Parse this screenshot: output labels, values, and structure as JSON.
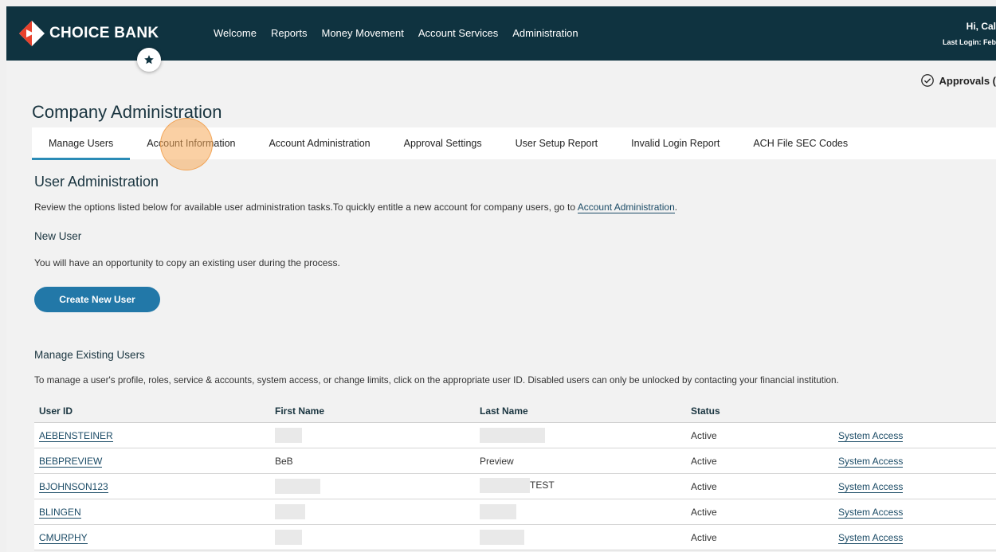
{
  "brand": {
    "name": "CHOICE BANK"
  },
  "nav": [
    "Welcome",
    "Reports",
    "Money Movement",
    "Account Services",
    "Administration"
  ],
  "user": {
    "greeting": "Hi, Cal",
    "last_login": "Last Login: Feb"
  },
  "approvals": {
    "label": "Approvals ("
  },
  "page": {
    "title": "Company Administration"
  },
  "tabs": [
    {
      "label": "Manage Users",
      "active": true
    },
    {
      "label": "Account Information"
    },
    {
      "label": "Account Administration"
    },
    {
      "label": "Approval Settings"
    },
    {
      "label": "User Setup Report"
    },
    {
      "label": "Invalid Login Report"
    },
    {
      "label": "ACH File SEC Codes"
    }
  ],
  "user_admin": {
    "title": "User Administration",
    "desc_text": "Review the options listed below for available user administration tasks.To quickly entitle a new account for company users, go to ",
    "desc_link": "Account Administration",
    "desc_tail": ".",
    "new_user_title": "New User",
    "new_user_desc": "You will have an opportunity to copy an existing user during the process.",
    "create_button": "Create New User",
    "manage_title": "Manage Existing Users",
    "manage_desc": "To manage a user's profile, roles, service & accounts, system access, or change limits, click on the appropriate user ID. Disabled users can only be unlocked by contacting your financial institution."
  },
  "table": {
    "headers": [
      "User ID",
      "First Name",
      "Last Name",
      "Status",
      ""
    ],
    "rows": [
      {
        "user_id": "AEBENSTEINER",
        "first_name": "",
        "last_name": "",
        "status": "Active",
        "action": "System Access"
      },
      {
        "user_id": "BEBPREVIEW",
        "first_name": "BeB",
        "last_name": "Preview",
        "status": "Active",
        "action": "System Access"
      },
      {
        "user_id": "BJOHNSON123",
        "first_name": "",
        "last_name": "TEST",
        "status": "Active",
        "action": "System Access"
      },
      {
        "user_id": "BLINGEN",
        "first_name": "",
        "last_name": "",
        "status": "Active",
        "action": "System Access"
      },
      {
        "user_id": "CMURPHY",
        "first_name": "",
        "last_name": "",
        "status": "Active",
        "action": "System Access"
      }
    ]
  },
  "colors": {
    "header_bg": "#0f3340",
    "accent": "#2278a8",
    "brand_red": "#e8412c"
  },
  "icons": {
    "logo": "diamond-arrow-icon",
    "favorite": "star-icon",
    "approvals": "check-circle-icon"
  }
}
